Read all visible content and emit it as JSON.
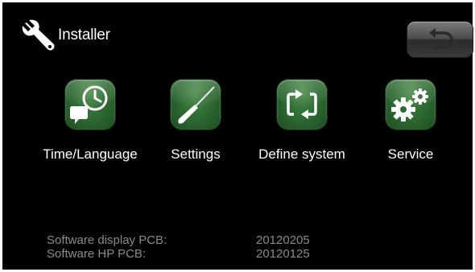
{
  "header": {
    "title": "Installer",
    "icon": "wrench-icon",
    "back_icon": "back-arrow-icon"
  },
  "tiles": [
    {
      "label": "Time/Language",
      "icon": "clock-speech-icon"
    },
    {
      "label": "Settings",
      "icon": "screwdriver-icon"
    },
    {
      "label": "Define system",
      "icon": "cycle-arrows-icon"
    },
    {
      "label": "Service",
      "icon": "gears-icon"
    }
  ],
  "software": [
    {
      "label": "Software display PCB:",
      "value": "20120205"
    },
    {
      "label": "Software HP PCB:",
      "value": "20120125"
    }
  ],
  "colors": {
    "background": "#000000",
    "tile_green": "#2f6c33",
    "text": "#ffffff",
    "info_text": "#8a8a8a"
  }
}
